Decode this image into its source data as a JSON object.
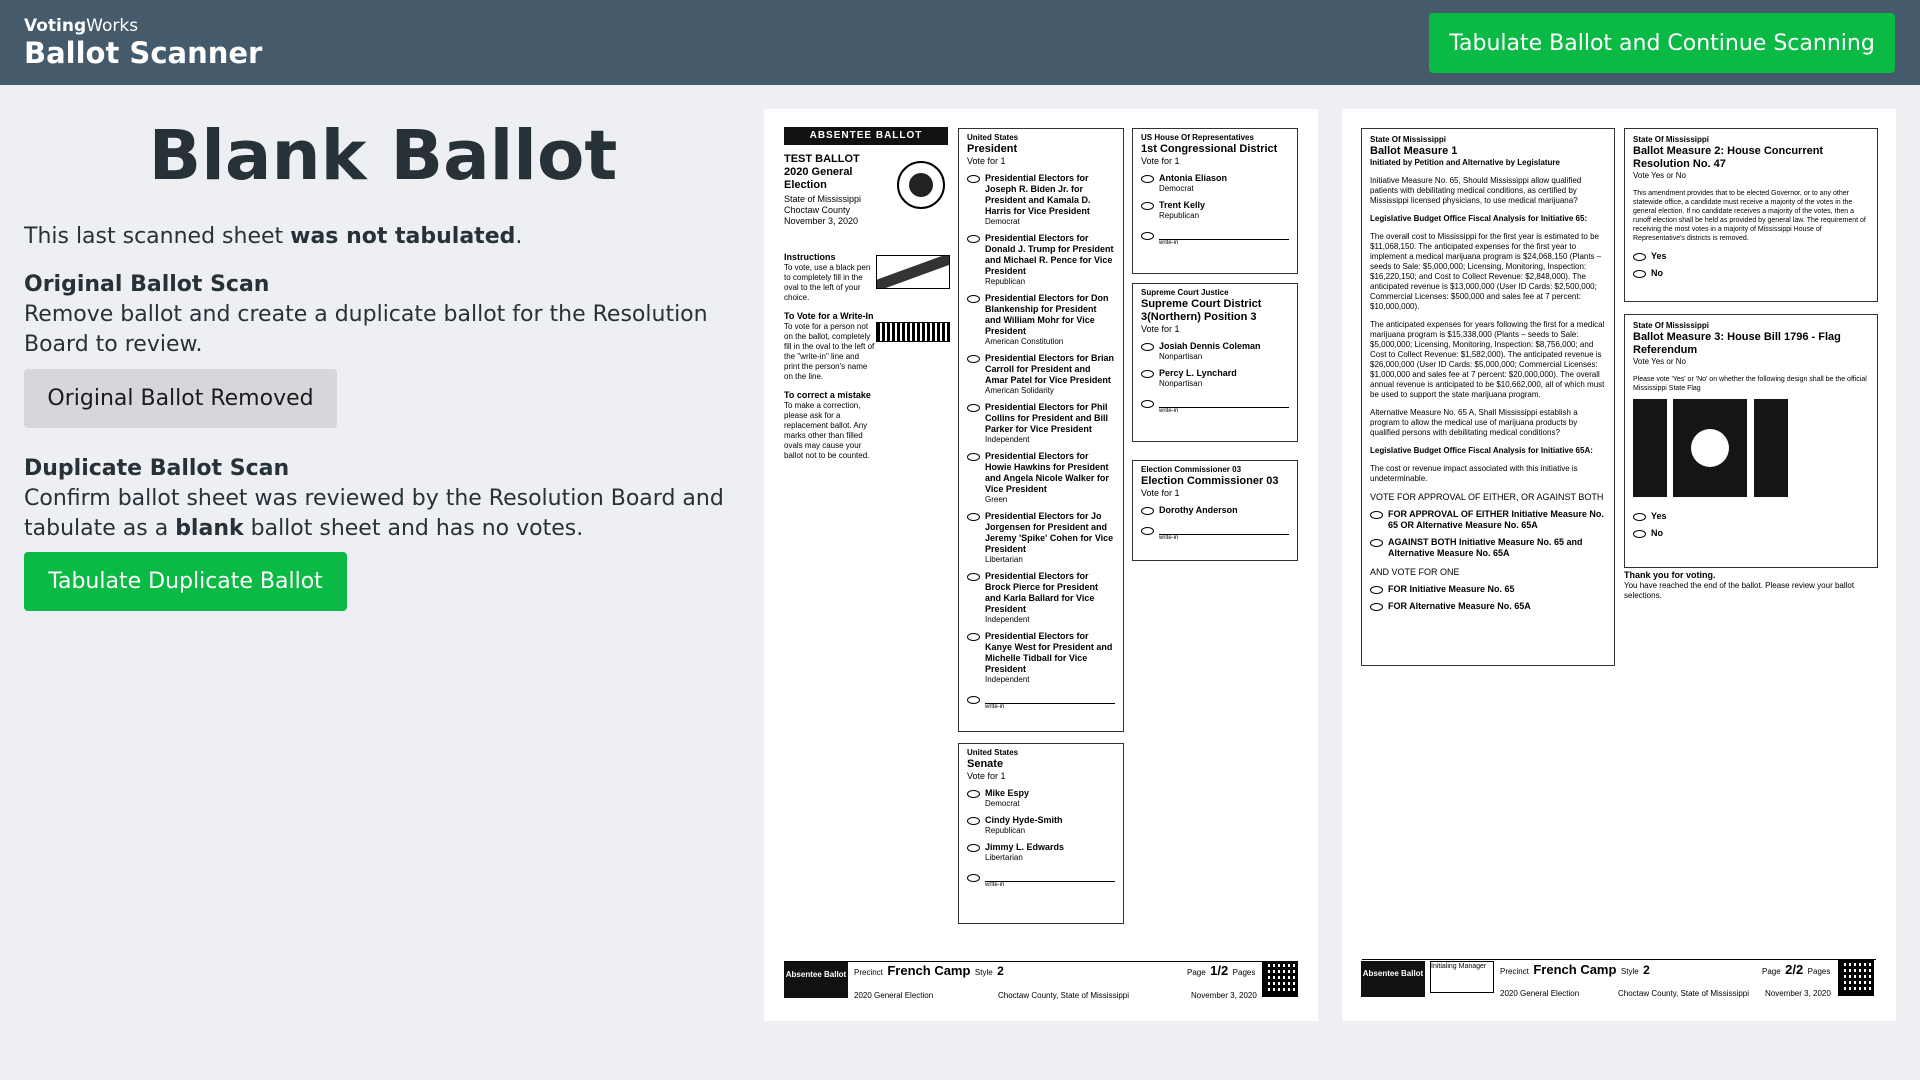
{
  "header": {
    "org_bold": "Voting",
    "org_rest": "Works",
    "app_name": "Ballot Scanner",
    "tabulate_continue_label": "Tabulate Ballot and Continue Scanning"
  },
  "main": {
    "title": "Blank Ballot",
    "intro_before": "This last scanned sheet ",
    "intro_bold": "was not tabulated",
    "intro_after": ".",
    "original": {
      "heading": "Original Ballot Scan",
      "text": "Remove ballot and create a duplicate ballot for the Resolution Board to review.",
      "button_label": "Original Ballot Removed"
    },
    "duplicate": {
      "heading": "Duplicate Ballot Scan",
      "text_before": "Confirm ballot sheet was reviewed by the Resolution Board and tabulate as a ",
      "text_bold": "blank",
      "text_after": " ballot sheet and has no votes.",
      "button_label": "Tabulate Duplicate Ballot"
    }
  },
  "ballot_page1": {
    "absentee_label": "ABSENTEE BALLOT",
    "test_title": "TEST BALLOT",
    "election": "2020 General Election",
    "state": "State of Mississippi",
    "county": "Choctaw County",
    "date": "November 3, 2020",
    "instructions_heading": "Instructions",
    "instructions_text": "To vote, use a black pen to completely fill in the oval to the left of your choice.",
    "writein_heading": "To Vote for a Write-In",
    "writein_text": "To vote for a person not on the ballot, completely fill in the oval to the left of the \"write-in\" line and print the person's name on the line.",
    "mistake_heading": "To correct a mistake",
    "mistake_text": "To make a correction, please ask for a replacement ballot. Any marks other than filled ovals may cause your ballot not to be counted.",
    "president": {
      "jurisdiction": "United States",
      "title": "President",
      "vote_for": "Vote for 1",
      "options": [
        {
          "name": "Presidential Electors for Joseph R. Biden Jr. for President and Kamala D. Harris for Vice President",
          "party": "Democrat"
        },
        {
          "name": "Presidential Electors for Donald J. Trump for President and Michael R. Pence for Vice President",
          "party": "Republican"
        },
        {
          "name": "Presidential Electors for Don Blankenship for President and William Mohr for Vice President",
          "party": "American Constitution"
        },
        {
          "name": "Presidential Electors for Brian Carroll for President and Amar Patel for Vice President",
          "party": "American Solidarity"
        },
        {
          "name": "Presidential Electors for Phil Collins for President and Bill Parker for Vice President",
          "party": "Independent"
        },
        {
          "name": "Presidential Electors for Howie Hawkins for President and Angela Nicole Walker for Vice President",
          "party": "Green"
        },
        {
          "name": "Presidential Electors for Jo Jorgensen for President and Jeremy 'Spike' Cohen for Vice President",
          "party": "Libertarian"
        },
        {
          "name": "Presidential Electors for Brock Pierce for President and Karla Ballard for Vice President",
          "party": "Independent"
        },
        {
          "name": "Presidential Electors for Kanye West for President and Michelle Tidball for Vice President",
          "party": "Independent"
        }
      ],
      "writein": "write-in"
    },
    "senate": {
      "jurisdiction": "United States",
      "title": "Senate",
      "vote_for": "Vote for 1",
      "options": [
        {
          "name": "Mike Espy",
          "party": "Democrat"
        },
        {
          "name": "Cindy Hyde-Smith",
          "party": "Republican"
        },
        {
          "name": "Jimmy L. Edwards",
          "party": "Libertarian"
        }
      ],
      "writein": "write-in"
    },
    "house": {
      "jurisdiction": "US House Of Representatives",
      "title": "1st Congressional District",
      "vote_for": "Vote for 1",
      "options": [
        {
          "name": "Antonia Eliason",
          "party": "Democrat"
        },
        {
          "name": "Trent Kelly",
          "party": "Republican"
        }
      ],
      "writein": "write-in"
    },
    "court": {
      "jurisdiction": "Supreme Court Justice",
      "title": "Supreme Court District 3(Northern) Position 3",
      "vote_for": "Vote for 1",
      "options": [
        {
          "name": "Josiah Dennis Coleman",
          "party": "Nonpartisan"
        },
        {
          "name": "Percy L. Lynchard",
          "party": "Nonpartisan"
        }
      ],
      "writein": "write-in"
    },
    "commissioner": {
      "jurisdiction": "Election Commissioner 03",
      "title": "Election Commissioner 03",
      "vote_for": "Vote for 1",
      "options": [
        {
          "name": "Dorothy Anderson",
          "party": ""
        }
      ],
      "writein": "write-in"
    },
    "footer": {
      "absentee": "Absentee Ballot",
      "precinct_label": "Precinct",
      "precinct": "French Camp",
      "style_label": "Style",
      "style": "2",
      "page_label": "Page",
      "page": "1/2",
      "pages_label": "Pages",
      "election": "2020 General Election",
      "county": "Choctaw County, State of Mississippi",
      "date": "November 3, 2020"
    }
  },
  "ballot_page2": {
    "measure1": {
      "jurisdiction": "State Of Mississippi",
      "title": "Ballot Measure 1",
      "subtitle": "Initiated by Petition and Alternative by Legislature",
      "p1": "Initiative Measure No. 65, Should Mississippi allow qualified patients with debilitating medical conditions, as certified by Mississippi licensed physicians, to use medical marijuana?",
      "p2": "Legislative Budget Office Fiscal Analysis for Initiative 65:",
      "p3": "The overall cost to Mississippi for the first year is estimated to be $11,068,150. The anticipated expenses for the first year to implement a medical marijuana program is $24,068,150 (Plants – seeds to Sale: $5,000,000; Licensing, Monitoring, Inspection: $16,220,150; and Cost to Collect Revenue: $2,848,000). The anticipated revenue is $13,000,000 (User ID Cards: $2,500,000; Commercial Licenses: $500,000 and sales fee at 7 percent: $10,000,000).",
      "p4": "The anticipated expenses for years following the first for a medical marijuana program is $15,338,000 (Plants – seeds to Sale: $5,000,000; Licensing, Monitoring, Inspection: $8,756,000; and Cost to Collect Revenue: $1,582,000). The anticipated revenue is $26,000,000 (User ID Cards: $5,000,000; Commercial Licenses: $1,000,000 and sales fee at 7 percent: $20,000,000). The overall annual revenue is anticipated to be $10,662,000, all of which must be used to support the state marijuana program.",
      "p5": "Alternative Measure No. 65 A, Shall Mississippi establish a program to allow the medical use of marijuana products by qualified persons with debilitating medical conditions?",
      "p6": "Legislative Budget Office Fiscal Analysis for Initiative 65A:",
      "p7": "The cost or revenue impact associated with this initiative is undeterminable.",
      "vote_either": "VOTE FOR APPROVAL OF EITHER, OR AGAINST BOTH",
      "opt_for_either": "FOR APPROVAL OF EITHER Initiative Measure No. 65 OR Alternative Measure No. 65A",
      "opt_against_both": "AGAINST BOTH Initiative Measure No. 65 and Alternative Measure No. 65A",
      "vote_one": "AND VOTE FOR ONE",
      "opt_65": "FOR Initiative Measure No. 65",
      "opt_65a": "FOR Alternative Measure No. 65A"
    },
    "measure2": {
      "jurisdiction": "State Of Mississippi",
      "title": "Ballot Measure 2: House Concurrent Resolution No. 47",
      "vote": "Vote Yes or No",
      "text": "This amendment provides that to be elected Governor, or to any other statewide office, a candidate must receive a majority of the votes in the general election. If no candidate receives a majority of the votes, then a runoff election shall be held as provided by general law. The requirement of receiving the most votes in a majority of Mississippi House of Representative's districts is removed.",
      "yes": "Yes",
      "no": "No"
    },
    "measure3": {
      "jurisdiction": "State Of Mississippi",
      "title": "Ballot Measure 3: House Bill 1796 - Flag Referendum",
      "vote": "Vote Yes or No",
      "text": "Please vote 'Yes' or 'No' on whether the following design shall be the official Mississippi State Flag",
      "yes": "Yes",
      "no": "No"
    },
    "thanks": "Thank you for voting.",
    "thanks_text": "You have reached the end of the ballot. Please review your ballot selections.",
    "footer": {
      "absentee": "Absentee Ballot",
      "initialing": "Initialing Manager",
      "precinct_label": "Precinct",
      "precinct": "French Camp",
      "style_label": "Style",
      "style": "2",
      "page_label": "Page",
      "page": "2/2",
      "pages_label": "Pages",
      "election": "2020 General Election",
      "county": "Choctaw County, State of Mississippi",
      "date": "November 3, 2020"
    }
  }
}
